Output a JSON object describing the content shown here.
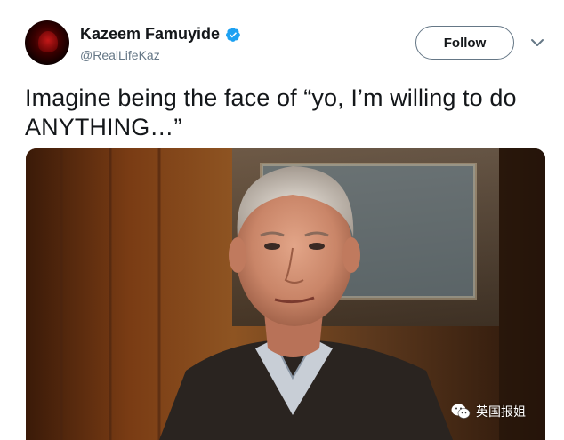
{
  "user": {
    "display_name": "Kazeem Famuyide",
    "handle": "@RealLifeKaz",
    "verified": true
  },
  "actions": {
    "follow_label": "Follow",
    "menu_icon": "chevron-down-icon"
  },
  "tweet": {
    "text": "Imagine being the face of “yo, I’m willing to do ANYTHING…”"
  },
  "media": {
    "watermark_text": "英国报姐",
    "watermark_icon": "wechat-icon"
  },
  "colors": {
    "text": "#14171a",
    "secondary": "#657786",
    "verified": "#1da1f2"
  }
}
